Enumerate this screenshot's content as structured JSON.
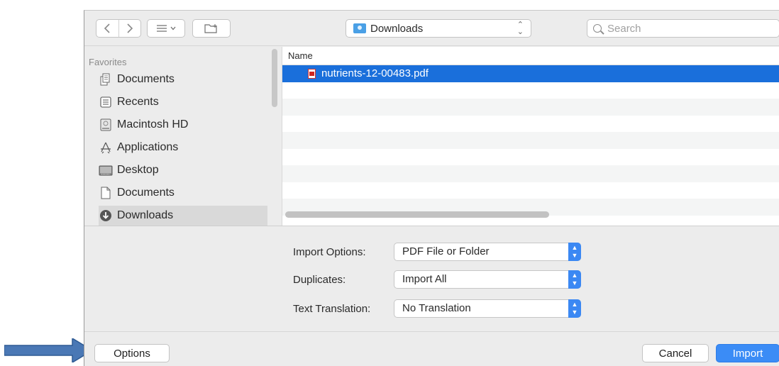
{
  "toolbar": {
    "back_icon": "chevron-left",
    "forward_icon": "chevron-right",
    "view_icon": "list-view",
    "new_folder_icon": "new-folder",
    "location": "Downloads",
    "search_placeholder": "Search"
  },
  "sidebar": {
    "section": "Favorites",
    "items": [
      {
        "label": "Documents",
        "icon": "documents-folder-icon"
      },
      {
        "label": "Recents",
        "icon": "recents-icon"
      },
      {
        "label": "Macintosh HD",
        "icon": "hard-drive-icon"
      },
      {
        "label": "Applications",
        "icon": "applications-icon"
      },
      {
        "label": "Desktop",
        "icon": "desktop-icon"
      },
      {
        "label": "Documents",
        "icon": "document-icon"
      },
      {
        "label": "Downloads",
        "icon": "downloads-icon"
      }
    ]
  },
  "filelist": {
    "column_header": "Name",
    "files": [
      {
        "name": "nutrients-12-00483.pdf",
        "selected": true
      }
    ]
  },
  "options": {
    "import_options": {
      "label": "Import Options:",
      "value": "PDF File or Folder"
    },
    "duplicates": {
      "label": "Duplicates:",
      "value": "Import All"
    },
    "text_translation": {
      "label": "Text Translation:",
      "value": "No Translation"
    }
  },
  "buttons": {
    "options": "Options",
    "cancel": "Cancel",
    "import": "Import"
  },
  "colors": {
    "accent": "#3b8cf6",
    "selection": "#1a6fdb",
    "annotation_arrow": "#3f72af"
  }
}
